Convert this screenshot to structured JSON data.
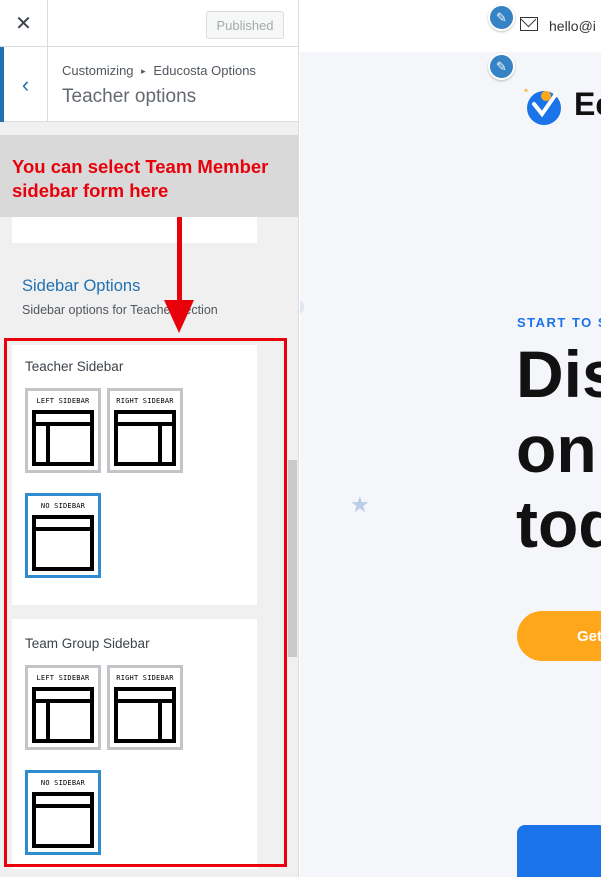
{
  "customizer": {
    "close_symbol": "✕",
    "published_label": "Published",
    "breadcrumb_root": "Customizing",
    "breadcrumb_sep": "▸",
    "breadcrumb_parent": "Educosta Options",
    "section_title": "Teacher options",
    "back_symbol": "‹"
  },
  "annotation": {
    "callout_text": "You can select Team Member sidebar form here",
    "color": "#e8000b"
  },
  "sidebar_options": {
    "title": "Sidebar Options",
    "description": "Sidebar options for Teacher section",
    "controls": [
      {
        "label": "Teacher Sidebar",
        "options": [
          {
            "label": "LEFT SIDEBAR",
            "layout": "left",
            "selected": false
          },
          {
            "label": "RIGHT SIDEBAR",
            "layout": "right",
            "selected": false
          },
          {
            "label": "NO SIDEBAR",
            "layout": "none",
            "selected": true
          }
        ]
      },
      {
        "label": "Team Group Sidebar",
        "options": [
          {
            "label": "LEFT SIDEBAR",
            "layout": "left",
            "selected": false
          },
          {
            "label": "RIGHT SIDEBAR",
            "layout": "right",
            "selected": false
          },
          {
            "label": "NO SIDEBAR",
            "layout": "none",
            "selected": true
          }
        ]
      }
    ]
  },
  "preview": {
    "email_text": "hello@i",
    "logo_text": "Ec",
    "hero_eyebrow": "START TO S",
    "hero_lines": [
      "Dis",
      "onl",
      "tod"
    ],
    "cta_label": "Get",
    "colors": {
      "accent_blue": "#1a73e8",
      "cta_orange": "#ffa71a"
    }
  }
}
